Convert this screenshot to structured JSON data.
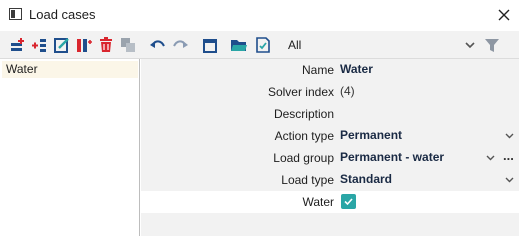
{
  "window": {
    "title": "Load cases"
  },
  "toolbar": {
    "icons": [
      "new-load-case-icon",
      "insert-load-case-icon",
      "edit-icon",
      "copy-icon",
      "delete-icon",
      "duplicate-icon",
      "undo-icon",
      "redo-icon",
      "print-icon",
      "open-folder-icon",
      "save-icon"
    ],
    "filter_value": "All"
  },
  "list": {
    "items": [
      {
        "label": "Water",
        "selected": true
      }
    ]
  },
  "properties": {
    "name": {
      "label": "Name",
      "value": "Water"
    },
    "solver_index": {
      "label": "Solver index",
      "value": "(4)"
    },
    "description": {
      "label": "Description",
      "value": ""
    },
    "action_type": {
      "label": "Action type",
      "value": "Permanent"
    },
    "load_group": {
      "label": "Load group",
      "value": "Permanent - water",
      "more": "..."
    },
    "load_type": {
      "label": "Load type",
      "value": "Standard"
    },
    "water": {
      "label": "Water",
      "checked": true
    }
  },
  "colors": {
    "accent": "#2aa6a6",
    "delete_red": "#d9262e",
    "icon_blue": "#1f4e8c",
    "selection_bg": "#fbf6e8"
  }
}
